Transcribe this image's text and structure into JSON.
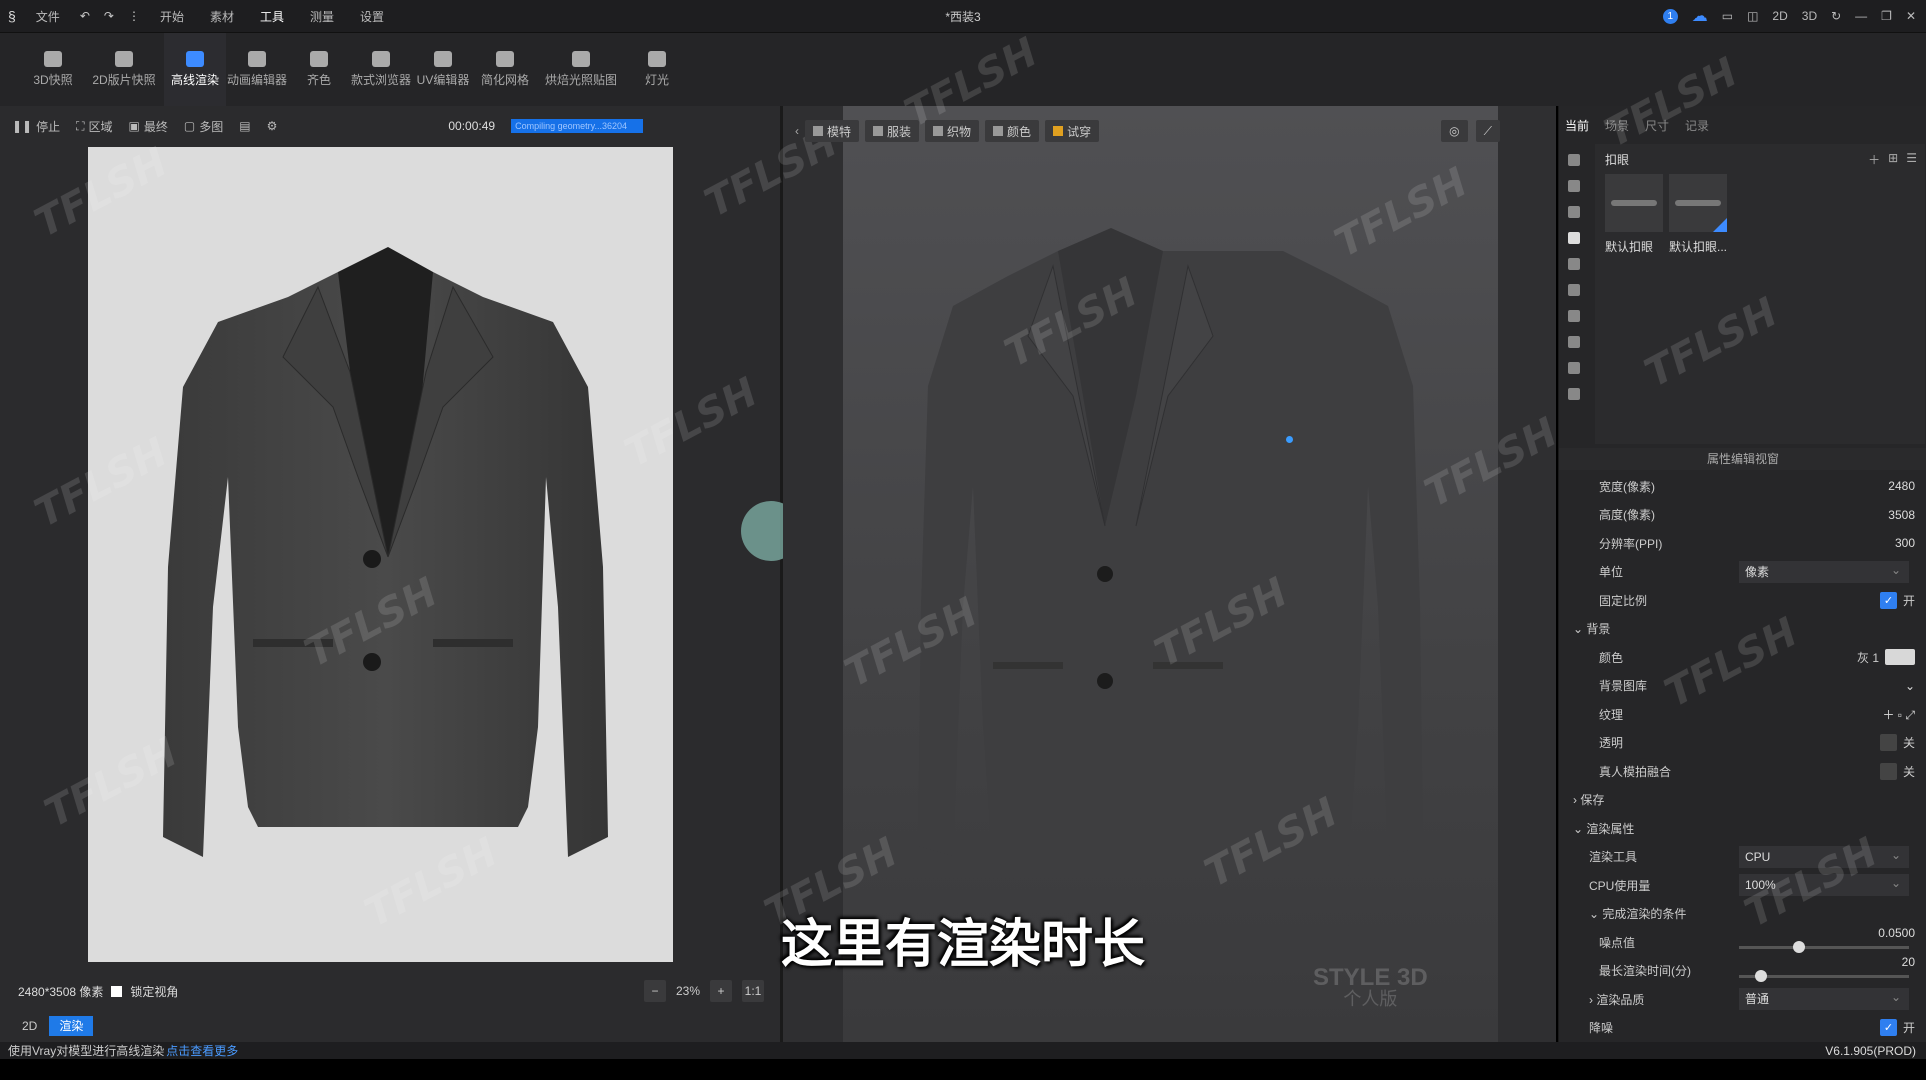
{
  "titlebar": {
    "menu_file": "文件",
    "menu_items": [
      "开始",
      "素材",
      "工具",
      "测量",
      "设置"
    ],
    "doc_title": "*西装3",
    "notif_count": "1",
    "view_2d": "2D",
    "view_3d": "3D"
  },
  "toolbar": {
    "tools": [
      {
        "label": "3D快照",
        "active": false
      },
      {
        "label": "2D版片快照",
        "active": false
      },
      {
        "label": "高线渲染",
        "active": true
      },
      {
        "label": "动画编辑器",
        "active": false
      },
      {
        "label": "齐色",
        "active": false
      },
      {
        "label": "款式浏览器",
        "active": false
      },
      {
        "label": "UV编辑器",
        "active": false
      },
      {
        "label": "简化网格",
        "active": false
      },
      {
        "label": "烘焙光照贴图",
        "active": false
      },
      {
        "label": "灯光",
        "active": false
      }
    ]
  },
  "render_panel": {
    "stop": "停止",
    "region": "区域",
    "final": "最终",
    "multi": "多图",
    "elapsed": "00:00:49",
    "progress_text": "Compiling geometry...36204",
    "size_label": "2480*3508 像素",
    "lock_view": "锁定视角",
    "zoom": "23%",
    "ratio": "1:1",
    "tab_2d": "2D",
    "tab_render": "渲染"
  },
  "viewport": {
    "buttons": [
      "模特",
      "服装",
      "织物",
      "颜色",
      "试穿"
    ],
    "watermark_line1": "STYLE 3D",
    "watermark_line2": "个人版"
  },
  "right_panel": {
    "tabs": [
      "当前",
      "场景",
      "尺寸",
      "记录"
    ],
    "library_title": "扣眼",
    "library_items": [
      "默认扣眼",
      "默认扣眼..."
    ],
    "props_title": "属性编辑视窗",
    "width_label": "宽度(像素)",
    "width_value": "2480",
    "height_label": "高度(像素)",
    "height_value": "3508",
    "ppi_label": "分辨率(PPI)",
    "ppi_value": "300",
    "unit_label": "单位",
    "unit_value": "像素",
    "ratio_label": "固定比例",
    "ratio_state": "开",
    "bg_section": "背景",
    "color_label": "颜色",
    "color_value": "灰 1",
    "bg_lib_label": "背景图库",
    "texture_label": "纹理",
    "transparent_label": "透明",
    "transparent_state": "关",
    "fusion_label": "真人模拍融合",
    "fusion_state": "关",
    "save_section": "保存",
    "render_section": "渲染属性",
    "engine_label": "渲染工具",
    "engine_value": "CPU",
    "cpu_label": "CPU使用量",
    "cpu_value": "100%",
    "finish_section": "完成渲染的条件",
    "noise_label": "噪点值",
    "noise_value": "0.0500",
    "noise_level": 0.35,
    "maxtime_label": "最长渲染时间(分)",
    "maxtime_value": "20",
    "maxtime_level": 0.13,
    "quality_label": "渲染品质",
    "quality_value": "普通",
    "denoise_label": "降噪",
    "denoise_state": "开"
  },
  "statusbar": {
    "message": "使用Vray对模型进行高线渲染",
    "link": "点击查看更多",
    "version": "V6.1.905(PROD)"
  },
  "subtitle": "这里有渲染时长",
  "watermark_text": "TFLSH",
  "colors": {
    "accent": "#2f7ff0",
    "bg_dark": "#262628",
    "canvas": "#dcdcdc"
  },
  "icons": [
    "logo-icon",
    "undo-icon",
    "redo-icon",
    "cloud-icon",
    "refresh-icon",
    "minimize-icon",
    "maximize-icon",
    "close-icon"
  ]
}
